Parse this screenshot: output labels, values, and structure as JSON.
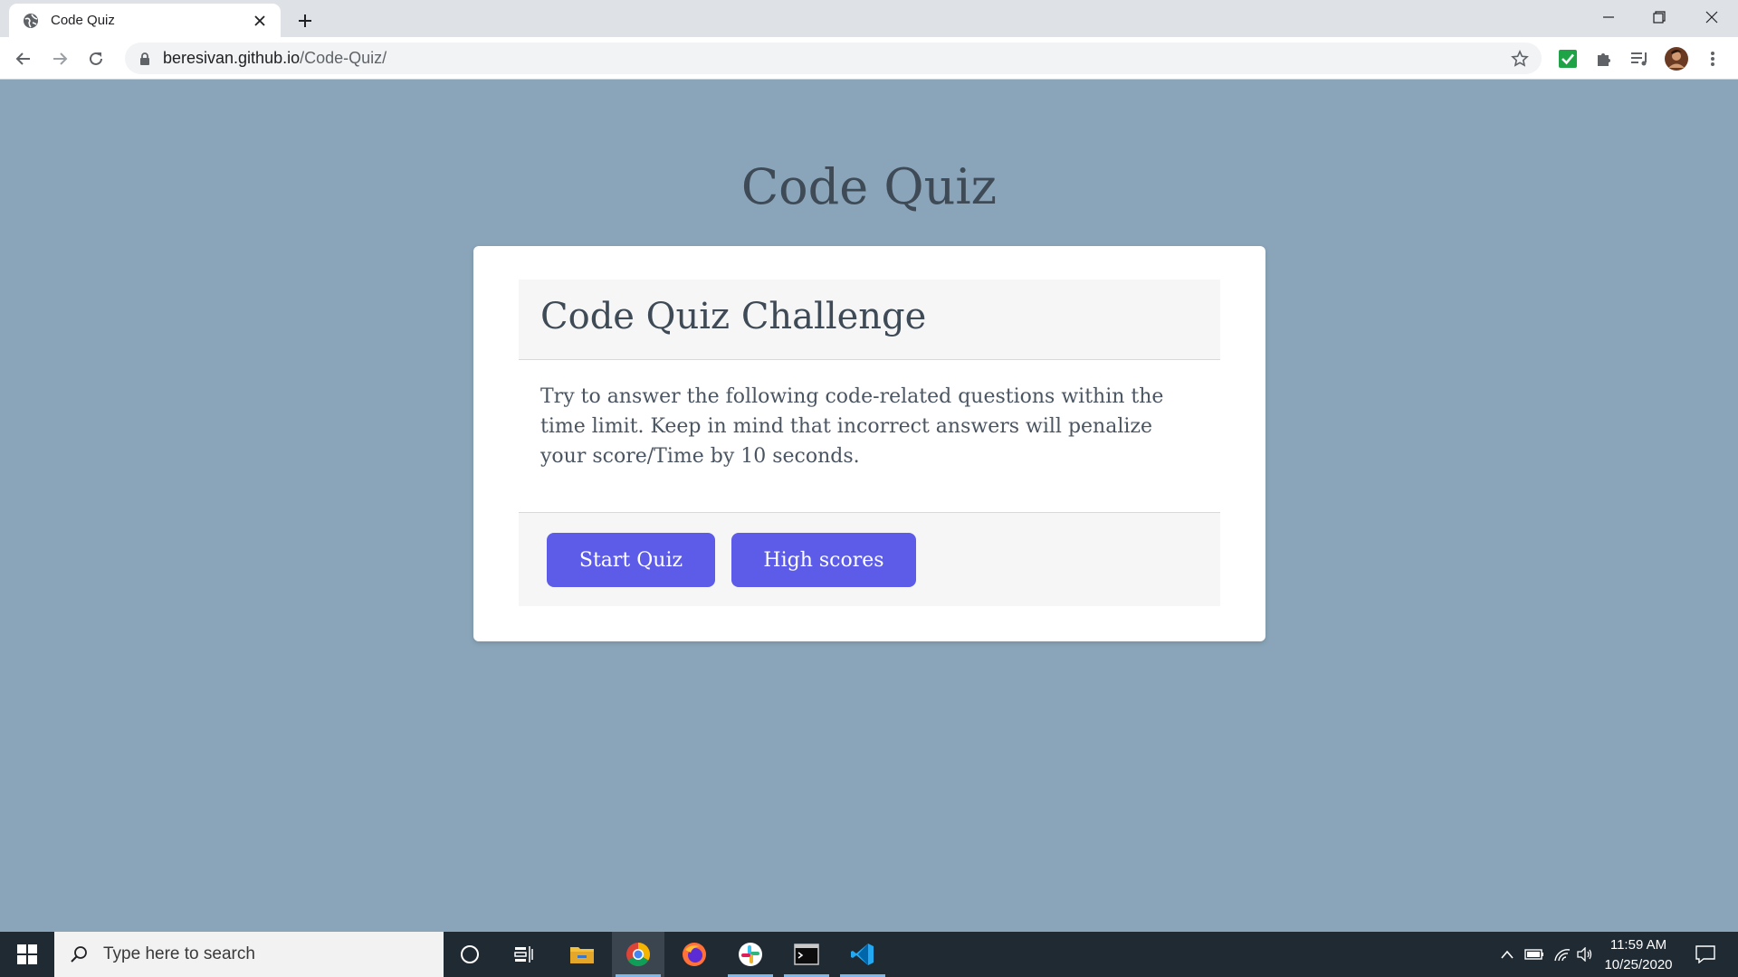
{
  "browser": {
    "tab_title": "Code Quiz",
    "url_host": "beresivan.github.io",
    "url_path": "/Code-Quiz/"
  },
  "page": {
    "title": "Code Quiz",
    "card": {
      "heading": "Code Quiz Challenge",
      "description": "Try to answer the following code-related questions within the time limit. Keep in mind that incorrect answers will penalize your score/Time by 10 seconds.",
      "start_label": "Start Quiz",
      "highscores_label": "High scores"
    }
  },
  "taskbar": {
    "search_placeholder": "Type here to search",
    "time": "11:59 AM",
    "date": "10/25/2020"
  },
  "colors": {
    "page_background": "#8aa5ba",
    "button": "#5c5ce8",
    "card": "#ffffff"
  }
}
